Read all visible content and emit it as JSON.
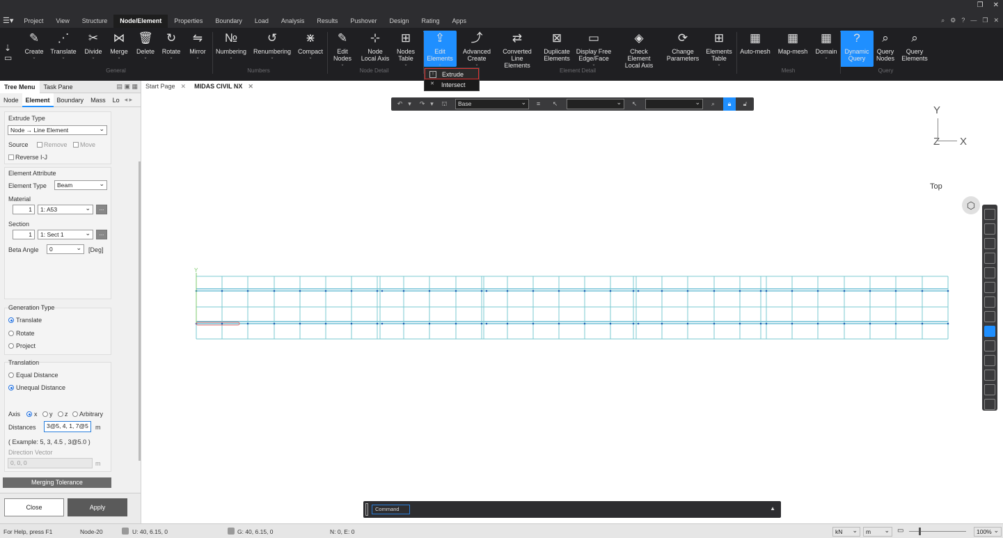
{
  "menubar": {
    "tabs": [
      "Project",
      "View",
      "Structure",
      "Node/Element",
      "Properties",
      "Boundary",
      "Load",
      "Analysis",
      "Results",
      "Pushover",
      "Design",
      "Rating",
      "Apps"
    ],
    "active": "Node/Element"
  },
  "ribbon": {
    "buttons": [
      {
        "l1": "Create",
        "l2": ""
      },
      {
        "l1": "Translate",
        "l2": ""
      },
      {
        "l1": "Divide",
        "l2": ""
      },
      {
        "l1": "Merge",
        "l2": ""
      },
      {
        "l1": "Delete",
        "l2": ""
      },
      {
        "l1": "Rotate",
        "l2": ""
      },
      {
        "l1": "Mirror",
        "l2": ""
      },
      {
        "l1": "Numbering",
        "l2": ""
      },
      {
        "l1": "Renumbering",
        "l2": ""
      },
      {
        "l1": "Compact",
        "l2": ""
      },
      {
        "l1": "Edit",
        "l2": "Nodes"
      },
      {
        "l1": "Node",
        "l2": "Local Axis"
      },
      {
        "l1": "Nodes",
        "l2": "Table"
      },
      {
        "l1": "Edit",
        "l2": "Elements"
      },
      {
        "l1": "Advanced",
        "l2": "Create"
      },
      {
        "l1": "Converted",
        "l2": "Line Elements"
      },
      {
        "l1": "Duplicate",
        "l2": "Elements"
      },
      {
        "l1": "Display Free",
        "l2": "Edge/Face"
      },
      {
        "l1": "Check Element",
        "l2": "Local Axis"
      },
      {
        "l1": "Change",
        "l2": "Parameters"
      },
      {
        "l1": "Elements",
        "l2": "Table"
      },
      {
        "l1": "Auto-mesh",
        "l2": ""
      },
      {
        "l1": "Map-mesh",
        "l2": ""
      },
      {
        "l1": "Domain",
        "l2": ""
      },
      {
        "l1": "Dynamic",
        "l2": "Query"
      },
      {
        "l1": "Query",
        "l2": "Nodes"
      },
      {
        "l1": "Query",
        "l2": "Elements"
      }
    ],
    "groups": [
      "General",
      "Numbers",
      "Node Detail",
      "Element Detail",
      "Mesh",
      "Query"
    ],
    "dropdown": [
      "Extrude",
      "Intersect"
    ]
  },
  "panel": {
    "head": [
      "Tree Menu",
      "Task Pane"
    ],
    "tabs": [
      "Node",
      "Element",
      "Boundary",
      "Mass",
      "Lo"
    ],
    "extrude_type_label": "Extrude Type",
    "extrude_type": "Node → Line Element",
    "source_label": "Source",
    "remove": "Remove",
    "move": "Move",
    "reverse": "Reverse I-J",
    "elem_attr_label": "Element Attribute",
    "elem_type_label": "Element Type",
    "elem_type": "Beam",
    "material_label": "Material",
    "material_no": "1",
    "material": "1: A53",
    "section_label": "Section",
    "section_no": "1",
    "section": "1: Sect 1",
    "beta_label": "Beta Angle",
    "beta": "0",
    "deg": "[Deg]",
    "gen_type_label": "Generation Type",
    "translate": "Translate",
    "rotate": "Rotate",
    "project": "Project",
    "translation_label": "Translation",
    "equal": "Equal Distance",
    "unequal": "Unequal Distance",
    "axis_label": "Axis",
    "ax": "x",
    "ay": "y",
    "az": "z",
    "arb": "Arbitrary",
    "dist_label": "Distances",
    "dist": "3@5, 4, 1, 7@5",
    "unit": "m",
    "example": "( Example: 5, 3, 4.5 , 3@5.0 )",
    "dirvec_label": "Direction Vector",
    "dirvec": "0, 0, 0",
    "unit2": "m",
    "merge": "Merging Tolerance",
    "close": "Close",
    "apply": "Apply"
  },
  "viewtabs": [
    "Start Page",
    "MIDAS CIVIL NX"
  ],
  "viewtool": {
    "sel1": "Base",
    "sel2": "",
    "sel3": ""
  },
  "axes": {
    "y": "Y",
    "z": "Z",
    "x": "X",
    "top": "Top",
    "model_y": "Y"
  },
  "cmd": "Command",
  "status": {
    "help": "For Help, press F1",
    "node": "Node-20",
    "u": "U: 40, 6.15, 0",
    "g": "G: 40, 6.15, 0",
    "ne": "N: 0, E: 0",
    "force": "kN",
    "len": "m",
    "zoom": "100%"
  }
}
